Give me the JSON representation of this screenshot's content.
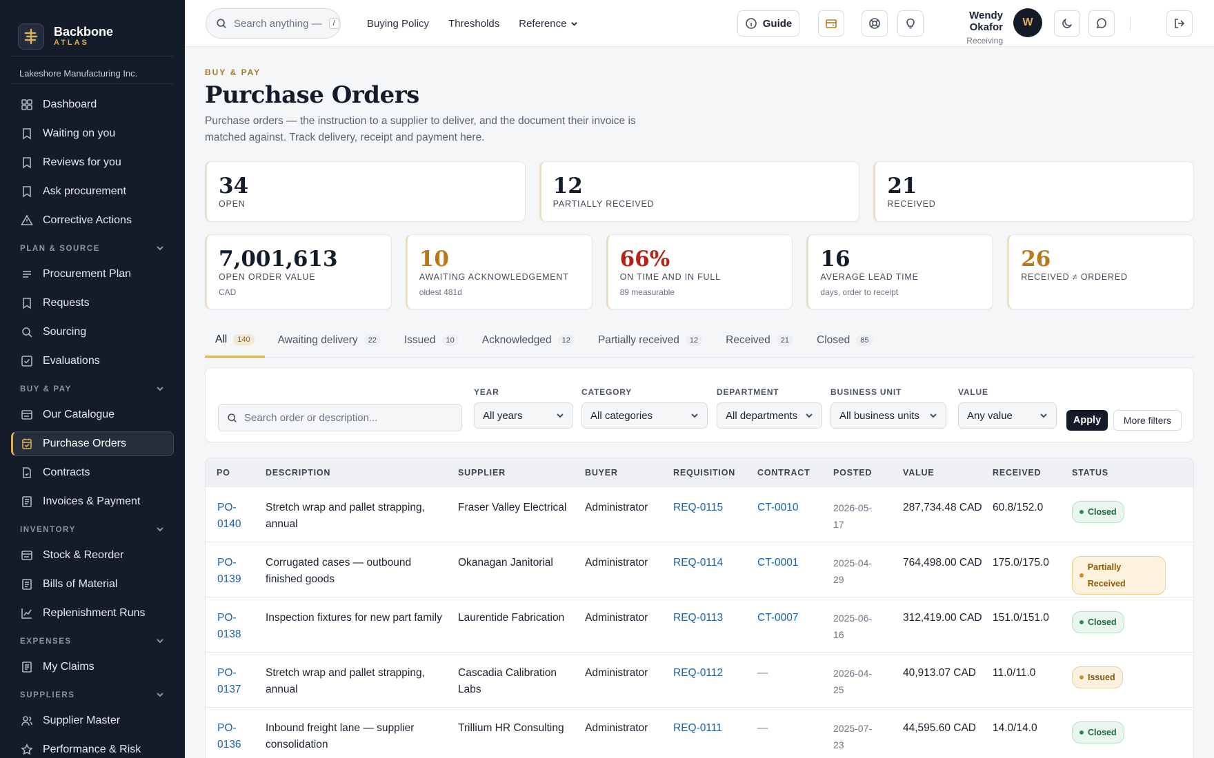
{
  "app": {
    "brand": "Backbone",
    "brand_sub": "ATLAS",
    "org": "Lakeshore Manufacturing Inc."
  },
  "sidebar": {
    "top_items": [
      {
        "label": "Dashboard",
        "icon": "grid-icon"
      },
      {
        "label": "Waiting on you",
        "icon": "bookmark-icon"
      },
      {
        "label": "Reviews for you",
        "icon": "bookmark-icon"
      },
      {
        "label": "Ask procurement",
        "icon": "bookmark-icon"
      },
      {
        "label": "Corrective Actions",
        "icon": "warning-icon"
      }
    ],
    "sections": [
      {
        "title": "PLAN & SOURCE",
        "items": [
          "Procurement Plan",
          "Requests",
          "Sourcing",
          "Evaluations"
        ]
      },
      {
        "title": "BUY & PAY",
        "items": [
          "Our Catalogue",
          "Purchase Orders",
          "Contracts",
          "Invoices & Payment"
        ]
      },
      {
        "title": "INVENTORY",
        "items": [
          "Stock & Reorder",
          "Bills of Material",
          "Replenishment Runs"
        ]
      },
      {
        "title": "EXPENSES",
        "items": [
          "My Claims"
        ]
      },
      {
        "title": "SUPPLIERS",
        "items": [
          "Supplier Master",
          "Performance & Risk"
        ]
      }
    ]
  },
  "topbar": {
    "search_placeholder": "Search anything —",
    "search_kbd": "/",
    "nav": [
      "Buying Policy",
      "Thresholds",
      "Reference"
    ],
    "guide": "Guide",
    "user_name": "Wendy Okafor",
    "user_role": "Receiving",
    "avatar": "W"
  },
  "page": {
    "eyebrow": "BUY & PAY",
    "title": "Purchase Orders",
    "description": "Purchase orders — the instruction to a supplier to deliver, and the document their invoice is matched against. Track delivery, receipt and payment here."
  },
  "stats_top": [
    {
      "value": "34",
      "label": "OPEN"
    },
    {
      "value": "12",
      "label": "PARTIALLY RECEIVED"
    },
    {
      "value": "21",
      "label": "RECEIVED"
    }
  ],
  "stats_bottom": [
    {
      "value": "7,001,613",
      "label": "OPEN ORDER VALUE",
      "sub": "CAD",
      "tone": ""
    },
    {
      "value": "10",
      "label": "AWAITING ACKNOWLEDGEMENT",
      "sub": "oldest 481d",
      "tone": "gold"
    },
    {
      "value": "66%",
      "label": "ON TIME AND IN FULL",
      "sub": "89 measurable",
      "tone": "red"
    },
    {
      "value": "16",
      "label": "AVERAGE LEAD TIME",
      "sub": "days, order to receipt",
      "tone": ""
    },
    {
      "value": "26",
      "label": "RECEIVED ≠ ORDERED",
      "sub": "",
      "tone": "gold"
    }
  ],
  "tabs": [
    {
      "label": "All",
      "count": "140"
    },
    {
      "label": "Awaiting delivery",
      "count": "22"
    },
    {
      "label": "Issued",
      "count": "10"
    },
    {
      "label": "Acknowledged",
      "count": "12"
    },
    {
      "label": "Partially received",
      "count": "12"
    },
    {
      "label": "Received",
      "count": "21"
    },
    {
      "label": "Closed",
      "count": "85"
    }
  ],
  "filters": {
    "search_placeholder": "Search order or description...",
    "year": {
      "label": "YEAR",
      "value": "All years"
    },
    "category": {
      "label": "CATEGORY",
      "value": "All categories"
    },
    "department": {
      "label": "DEPARTMENT",
      "value": "All departments"
    },
    "business_unit": {
      "label": "BUSINESS UNIT",
      "value": "All business units"
    },
    "value": {
      "label": "VALUE",
      "value": "Any value"
    },
    "apply": "Apply",
    "more": "More filters"
  },
  "table": {
    "columns": [
      "PO",
      "DESCRIPTION",
      "SUPPLIER",
      "BUYER",
      "REQUISITION",
      "CONTRACT",
      "POSTED",
      "VALUE",
      "RECEIVED",
      "STATUS"
    ],
    "rows": [
      {
        "po": "PO-\n0140",
        "desc": "Stretch wrap and pallet strapping, annual",
        "supplier": "Fraser Valley Electrical",
        "buyer": "Administrator",
        "req": "REQ-0115",
        "contract": "CT-0010",
        "posted": "2026-05-\n17",
        "value": "287,734.48 CAD",
        "received": "60.8/152.0",
        "status": "Closed",
        "status_type": "closed"
      },
      {
        "po": "PO-\n0139",
        "desc": "Corrugated cases — outbound finished goods",
        "supplier": "Okanagan Janitorial",
        "buyer": "Administrator",
        "req": "REQ-0114",
        "contract": "CT-0001",
        "posted": "2025-04-\n29",
        "value": "764,498.00 CAD",
        "received": "175.0/175.0",
        "status": "Partially Received",
        "status_type": "partial"
      },
      {
        "po": "PO-\n0138",
        "desc": "Inspection fixtures for new part family",
        "supplier": "Laurentide Fabrication",
        "buyer": "Administrator",
        "req": "REQ-0113",
        "contract": "CT-0007",
        "posted": "2025-06-\n16",
        "value": "312,419.00 CAD",
        "received": "151.0/151.0",
        "status": "Closed",
        "status_type": "closed"
      },
      {
        "po": "PO-\n0137",
        "desc": "Stretch wrap and pallet strapping, annual",
        "supplier": "Cascadia Calibration Labs",
        "buyer": "Administrator",
        "req": "REQ-0112",
        "contract": "—",
        "posted": "2026-04-\n25",
        "value": "40,913.07 CAD",
        "received": "11.0/11.0",
        "status": "Issued",
        "status_type": "issued"
      },
      {
        "po": "PO-\n0136",
        "desc": "Inbound freight lane — supplier consolidation",
        "supplier": "Trillium HR Consulting",
        "buyer": "Administrator",
        "req": "REQ-0111",
        "contract": "—",
        "posted": "2025-07-\n23",
        "value": "44,595.60 CAD",
        "received": "14.0/14.0",
        "status": "Closed",
        "status_type": "closed"
      }
    ]
  },
  "colors": {
    "sidebar_bg": "#141b29",
    "accent_gold": "#d9b15c",
    "link": "#1f5fa8",
    "danger": "#b42318"
  }
}
